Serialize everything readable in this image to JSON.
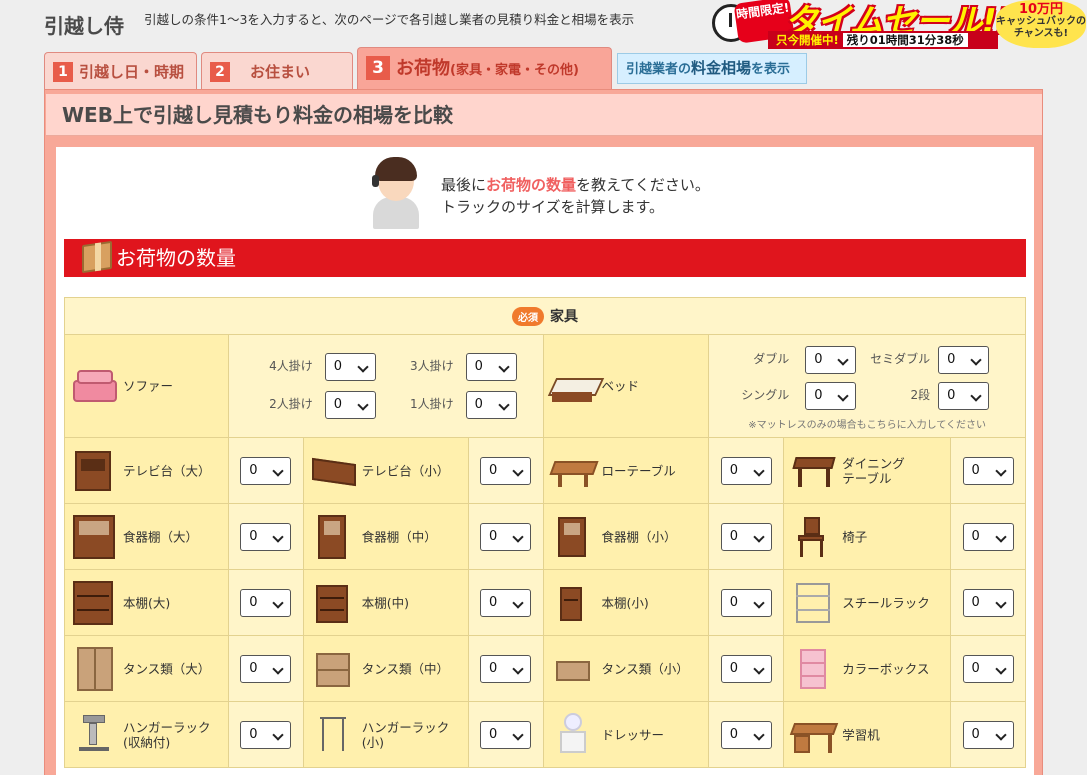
{
  "header": {
    "logo": "引越し侍",
    "note": "引越しの条件1〜3を入力すると、次のページで各引越し業者の見積り料金と相場を表示"
  },
  "banner": {
    "limited": "時間限定!",
    "title": "タイムセール!!",
    "live": "只今開催中!",
    "remain": "残り01時間31分38秒",
    "cash_amount": "10万円",
    "cash_text": "キャッシュバックのチャンスも!"
  },
  "tabs": [
    {
      "num": "1",
      "label": "引越し日・時期"
    },
    {
      "num": "2",
      "label": "お住まい"
    },
    {
      "num": "3",
      "label": "お荷物",
      "sub": "(家具・家電・その他)"
    }
  ],
  "rate_link": {
    "pre": "引越業者の",
    "big": "料金相場",
    "post": "を表示"
  },
  "page_heading": "WEB上で引越し見積もり料金の相場を比較",
  "intro": {
    "l1a": "最後に",
    "l1b": "お荷物の数量",
    "l1c": "を教えてください。",
    "l2": "トラックのサイズを計算します。"
  },
  "section_title": "お荷物の数量",
  "furniture": {
    "badge": "必須",
    "caption": "家具",
    "sofa": {
      "name": "ソファー",
      "opts": [
        {
          "label": "4人掛け",
          "value": "0"
        },
        {
          "label": "3人掛け",
          "value": "0"
        },
        {
          "label": "2人掛け",
          "value": "0"
        },
        {
          "label": "1人掛け",
          "value": "0"
        }
      ]
    },
    "bed": {
      "name": "ベッド",
      "opts": [
        {
          "label": "ダブル",
          "value": "0"
        },
        {
          "label": "セミダブル",
          "value": "0"
        },
        {
          "label": "シングル",
          "value": "0"
        },
        {
          "label": "2段",
          "value": "0"
        }
      ],
      "note": "※マットレスのみの場合もこちらに入力してください"
    },
    "items": [
      {
        "name": "テレビ台（大）",
        "value": "0"
      },
      {
        "name": "テレビ台（小）",
        "value": "0"
      },
      {
        "name": "ローテーブル",
        "value": "0"
      },
      {
        "name": "ダイニング\nテーブル",
        "value": "0"
      },
      {
        "name": "食器棚（大）",
        "value": "0"
      },
      {
        "name": "食器棚（中）",
        "value": "0"
      },
      {
        "name": "食器棚（小）",
        "value": "0"
      },
      {
        "name": "椅子",
        "value": "0"
      },
      {
        "name": "本棚(大)",
        "value": "0"
      },
      {
        "name": "本棚(中)",
        "value": "0"
      },
      {
        "name": "本棚(小)",
        "value": "0"
      },
      {
        "name": "スチールラック",
        "value": "0"
      },
      {
        "name": "タンス類（大）",
        "value": "0"
      },
      {
        "name": "タンス類（中）",
        "value": "0"
      },
      {
        "name": "タンス類（小）",
        "value": "0"
      },
      {
        "name": "カラーボックス",
        "value": "0"
      },
      {
        "name": "ハンガーラック\n(収納付)",
        "value": "0"
      },
      {
        "name": "ハンガーラック\n(小)",
        "value": "0"
      },
      {
        "name": "ドレッサー",
        "value": "0"
      },
      {
        "name": "学習机",
        "value": "0"
      }
    ]
  }
}
